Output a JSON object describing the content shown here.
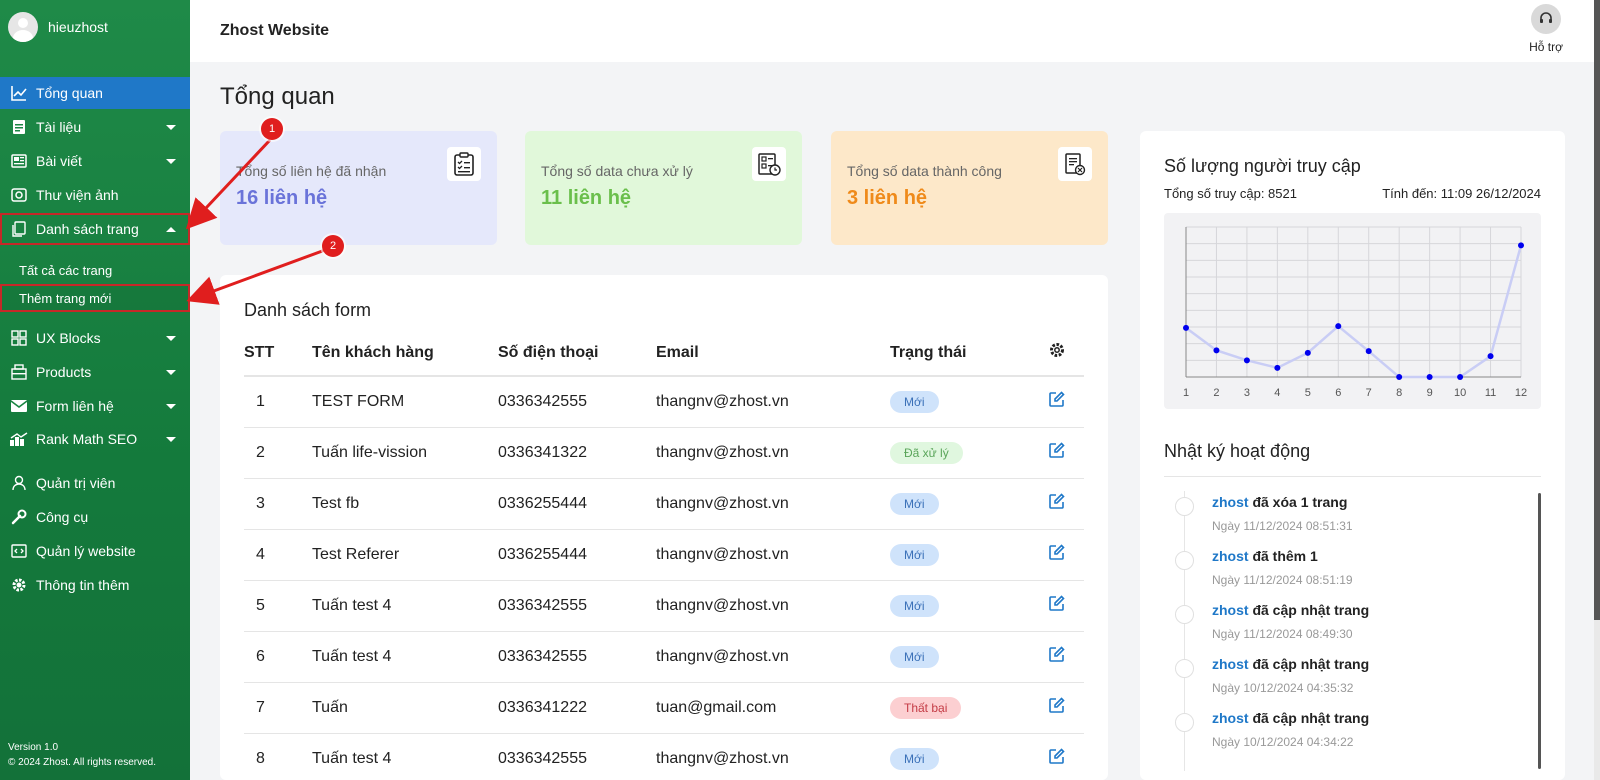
{
  "sidebar": {
    "user_name": "hieuzhost",
    "items": [
      {
        "label": "Tổng quan",
        "icon": "chart-line-icon"
      },
      {
        "label": "Tài liệu",
        "icon": "document-icon"
      },
      {
        "label": "Bài viết",
        "icon": "newspaper-icon"
      },
      {
        "label": "Thư viện ảnh",
        "icon": "camera-icon"
      },
      {
        "label": "Danh sách trang",
        "icon": "pages-icon"
      },
      {
        "label": "UX Blocks",
        "icon": "grid-icon"
      },
      {
        "label": "Products",
        "icon": "box-icon"
      },
      {
        "label": "Form liên hệ",
        "icon": "mail-icon"
      },
      {
        "label": "Rank Math SEO",
        "icon": "rank-icon"
      },
      {
        "label": "Quản trị viên",
        "icon": "user-icon"
      },
      {
        "label": "Công cụ",
        "icon": "wrench-icon"
      },
      {
        "label": "Quản lý website",
        "icon": "code-window-icon"
      },
      {
        "label": "Thông tin thêm",
        "icon": "gear-icon"
      }
    ],
    "submenu": [
      {
        "label": "Tất cả các trang"
      },
      {
        "label": "Thêm trang mới"
      }
    ],
    "version": "Version 1.0",
    "copyright": "© 2024 Zhost. All rights reserved."
  },
  "topbar": {
    "site_title": "Zhost Website",
    "support_label": "Hỗ trợ"
  },
  "page_title": "Tổng quan",
  "stats": [
    {
      "label": "Tổng số liên hệ đã nhận",
      "value": "16 liên hệ",
      "color": "#6a73d9",
      "bg": "#e5e8fb",
      "icon": "clipboard-check-icon"
    },
    {
      "label": "Tổng số data chưa xử lý",
      "value": "11 liên hệ",
      "color": "#6abf4b",
      "bg": "#e1f8da",
      "icon": "list-pending-icon"
    },
    {
      "label": "Tổng số data thành công",
      "value": "3 liên hệ",
      "color": "#ef8a1a",
      "bg": "#fde8c9",
      "icon": "file-check-icon"
    }
  ],
  "form": {
    "title": "Danh sách form",
    "headers": {
      "stt": "STT",
      "name": "Tên khách hàng",
      "phone": "Số điện thoại",
      "email": "Email",
      "status": "Trạng thái"
    },
    "rows": [
      {
        "stt": "1",
        "name": "TEST FORM",
        "phone": "0336342555",
        "email": "thangnv@zhost.vn",
        "status": "Mới",
        "kind": "new"
      },
      {
        "stt": "2",
        "name": "Tuấn life-vission",
        "phone": "0336341322",
        "email": "thangnv@zhost.vn",
        "status": "Đã xử lý",
        "kind": "done"
      },
      {
        "stt": "3",
        "name": "Test fb",
        "phone": "0336255444",
        "email": "thangnv@zhost.vn",
        "status": "Mới",
        "kind": "new"
      },
      {
        "stt": "4",
        "name": "Test Referer",
        "phone": "0336255444",
        "email": "thangnv@zhost.vn",
        "status": "Mới",
        "kind": "new"
      },
      {
        "stt": "5",
        "name": "Tuấn test 4",
        "phone": "0336342555",
        "email": "thangnv@zhost.vn",
        "status": "Mới",
        "kind": "new"
      },
      {
        "stt": "6",
        "name": "Tuấn test 4",
        "phone": "0336342555",
        "email": "thangnv@zhost.vn",
        "status": "Mới",
        "kind": "new"
      },
      {
        "stt": "7",
        "name": "Tuấn",
        "phone": "0336341222",
        "email": "tuan@gmail.com",
        "status": "Thất bại",
        "kind": "fail"
      },
      {
        "stt": "8",
        "name": "Tuấn test 4",
        "phone": "0336342555",
        "email": "thangnv@zhost.vn",
        "status": "Mới",
        "kind": "new"
      }
    ]
  },
  "visitors": {
    "title": "Số lượng người truy cập",
    "total": "Tổng số truy cập: 8521",
    "until": "Tính đến: 11:09 26/12/2024"
  },
  "chart_data": {
    "type": "line",
    "x": [
      "1",
      "2",
      "3",
      "4",
      "5",
      "6",
      "7",
      "8",
      "9",
      "10",
      "11",
      "12"
    ],
    "values": [
      590,
      320,
      200,
      110,
      290,
      610,
      310,
      0,
      0,
      0,
      250,
      1580
    ],
    "ylim": [
      0,
      1800
    ],
    "grid": true,
    "color": "#0000ee"
  },
  "log": {
    "title": "Nhật ký hoạt động",
    "items": [
      {
        "user": "zhost",
        "action": " đã xóa 1 trang",
        "date": "Ngày 11/12/2024 08:51:31"
      },
      {
        "user": "zhost",
        "action": " đã thêm 1",
        "date": "Ngày 11/12/2024 08:51:19"
      },
      {
        "user": "zhost",
        "action": " đã cập nhật trang",
        "date": "Ngày 11/12/2024 08:49:30"
      },
      {
        "user": "zhost",
        "action": " đã cập nhật trang",
        "date": "Ngày 10/12/2024 04:35:32"
      },
      {
        "user": "zhost",
        "action": " đã cập nhật trang",
        "date": "Ngày 10/12/2024 04:34:22"
      }
    ]
  },
  "callouts": [
    "1",
    "2"
  ],
  "colors": {
    "sidebar": "#1a8543",
    "active": "#1f78c8",
    "callout": "#e01e1e",
    "link": "#1f78c8"
  }
}
